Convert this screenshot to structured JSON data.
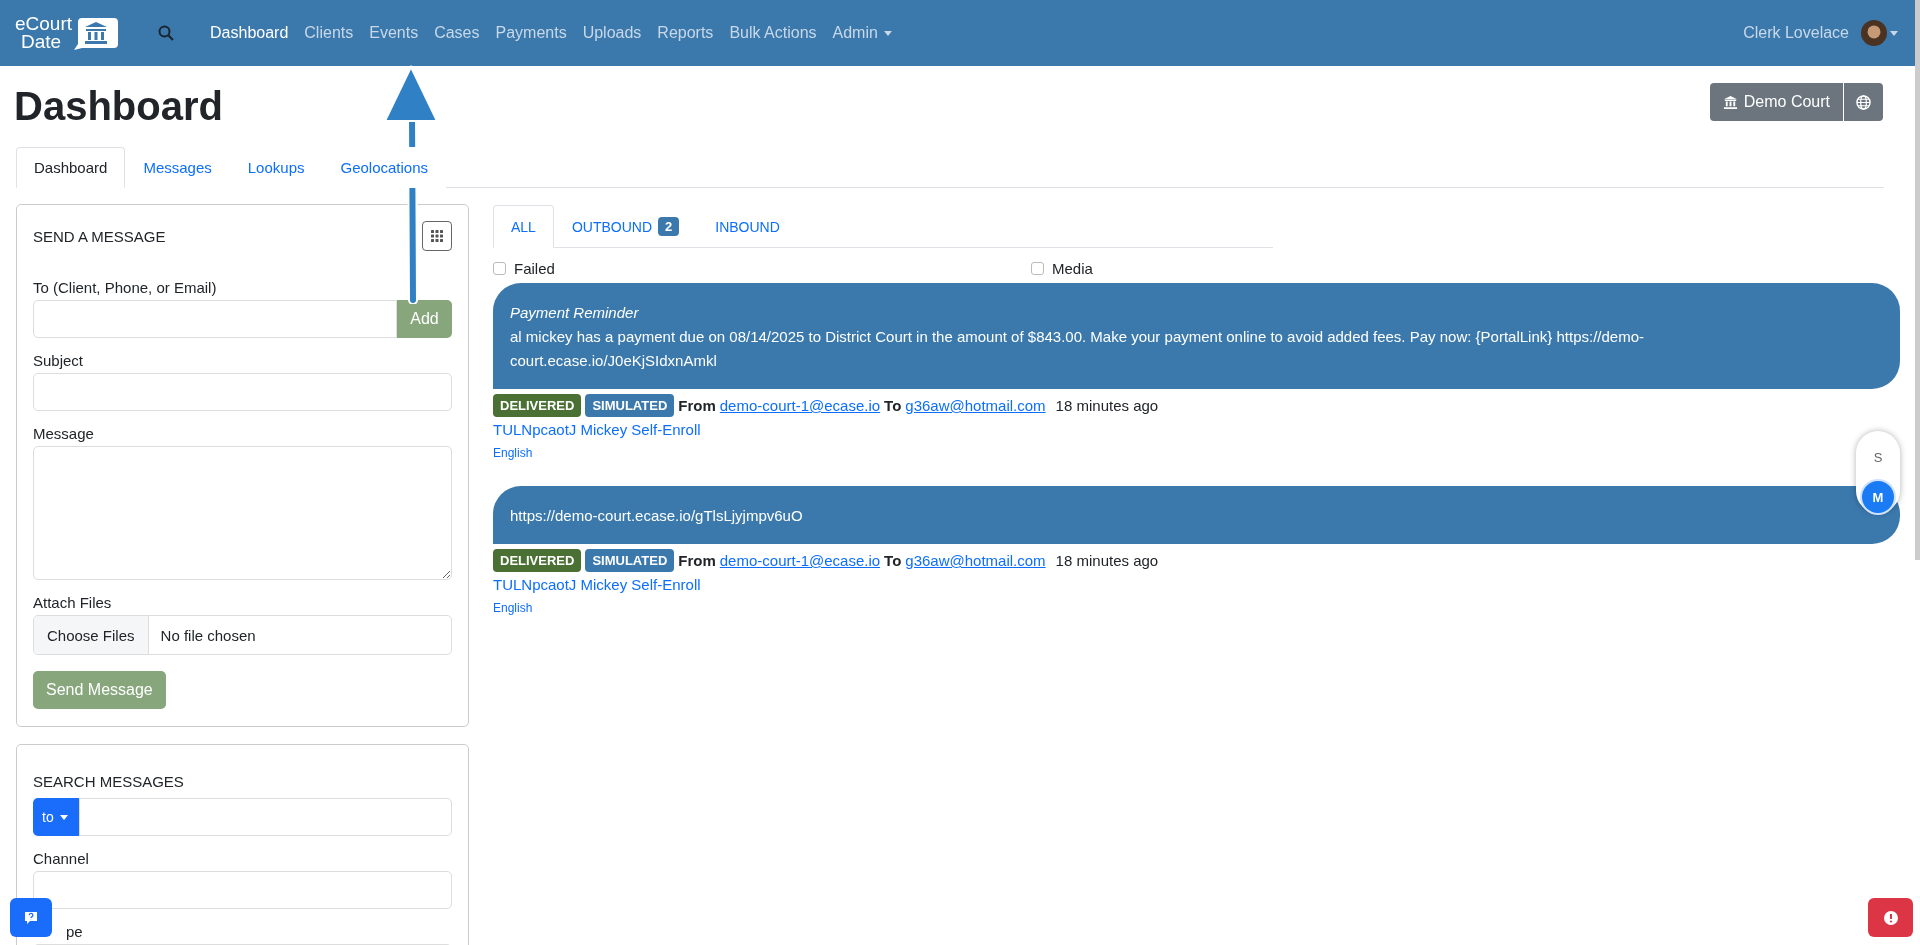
{
  "navbar": {
    "logo_lines": [
      "eCourt",
      "Date"
    ],
    "items": [
      {
        "label": "Dashboard",
        "selected": true
      },
      {
        "label": "Clients",
        "selected": false
      },
      {
        "label": "Events",
        "selected": false
      },
      {
        "label": "Cases",
        "selected": false
      },
      {
        "label": "Payments",
        "selected": false
      },
      {
        "label": "Uploads",
        "selected": false
      },
      {
        "label": "Reports",
        "selected": false
      },
      {
        "label": "Bulk Actions",
        "selected": false
      }
    ],
    "admin_menu": "Admin",
    "user": "Clerk Lovelace"
  },
  "page": {
    "title": "Dashboard",
    "court_button": "Demo Court"
  },
  "tabs": [
    {
      "label": "Dashboard",
      "selected": true
    },
    {
      "label": "Messages",
      "selected": false
    },
    {
      "label": "Lookups",
      "selected": false
    },
    {
      "label": "Geolocations",
      "selected": false
    }
  ],
  "send_form": {
    "title": "SEND A MESSAGE",
    "to_label": "To (Client, Phone, or Email)",
    "add_button": "Add",
    "subject_label": "Subject",
    "message_label": "Message",
    "attach_label": "Attach Files",
    "choose_button": "Choose Files",
    "file_status": "No file chosen",
    "send_button": "Send Message"
  },
  "search_form": {
    "title": "SEARCH MESSAGES",
    "field_dropdown": "to",
    "channel_label": "Channel",
    "type_label": "pe"
  },
  "message_tabs": [
    {
      "label": "ALL",
      "selected": true
    },
    {
      "label": "OUTBOUND",
      "selected": false,
      "count": "2"
    },
    {
      "label": "INBOUND",
      "selected": false
    }
  ],
  "filters": [
    {
      "label": "Failed",
      "checked": false
    },
    {
      "label": "Media",
      "checked": false
    }
  ],
  "messages": [
    {
      "subject": "Payment Reminder",
      "body": "al mickey has a payment due on 08/14/2025 to District Court in the amount of $843.00. Make your payment online to avoid added fees. Pay now: {PortalLink} https://demo-court.ecase.io/J0eKjSIdxnAmkl",
      "badges": [
        {
          "label": "DELIVERED",
          "color": "#4a7034"
        },
        {
          "label": "SIMULATED",
          "color": "#3b79ad"
        }
      ],
      "from_label": "From",
      "from": "demo-court-1@ecase.io",
      "to_label": "To",
      "to": "g36aw@hotmail.com",
      "time": "18 minutes ago",
      "client": "TULNpcaotJ Mickey Self-Enroll",
      "language": "English"
    },
    {
      "body": "https://demo-court.ecase.io/gTlsLjyjmpv6uO",
      "badges": [
        {
          "label": "DELIVERED",
          "color": "#4a7034"
        },
        {
          "label": "SIMULATED",
          "color": "#3b79ad"
        }
      ],
      "from_label": "From",
      "from": "demo-court-1@ecase.io",
      "to_label": "To",
      "to": "g36aw@hotmail.com",
      "time": "18 minutes ago",
      "client": "TULNpcaotJ Mickey Self-Enroll",
      "language": "English"
    }
  ],
  "side_toggle": [
    {
      "label": "S",
      "selected": false
    },
    {
      "label": "M",
      "selected": true
    }
  ]
}
